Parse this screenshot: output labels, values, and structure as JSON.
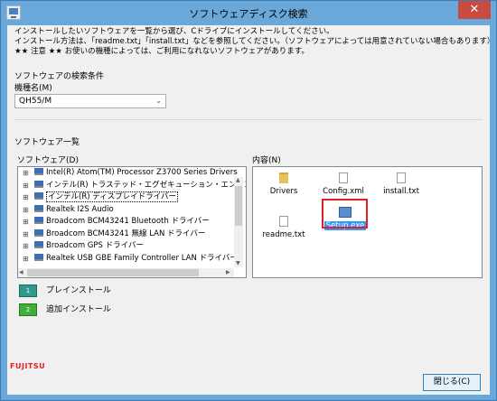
{
  "window": {
    "title": "ソフトウェアディスク検索",
    "close_glyph": "✕"
  },
  "intro": {
    "line1": "インストールしたいソフトウェアを一覧から選び、Cドライブにインストールしてください。",
    "line2": "インストール方法は、「readme.txt」「install.txt」などを参照してください。（ソフトウェアによっては用意されていない場合もあります）",
    "line3": "★★ 注意 ★★ お使いの機種によっては、ご利用になれないソフトウェアがあります。"
  },
  "search": {
    "section_label": "ソフトウェアの検索条件",
    "model_label": "機種名(M)",
    "model_value": "QH55/M"
  },
  "list": {
    "section_label": "ソフトウェア一覧",
    "software_label": "ソフトウェア(D)",
    "items": [
      "Intel(R) Atom(TM) Processor Z3700 Series Drivers",
      "インテル(R) トラステッド・エグゼキューション・エンジン",
      "インテル(R) ディスプレイドライバー",
      "Realtek I2S Audio",
      "Broadcom BCM43241 Bluetooth ドライバー",
      "Broadcom BCM43241 無線 LAN ドライバー",
      "Broadcom GPS ドライバー",
      "Realtek USB GBE Family Controller LAN ドライバー"
    ],
    "expander": "⊞"
  },
  "contents": {
    "label": "内容(N)",
    "files": [
      {
        "name": "Drivers",
        "icon": "folder-icon"
      },
      {
        "name": "Config.xml",
        "icon": "document-icon"
      },
      {
        "name": "install.txt",
        "icon": "document-icon"
      },
      {
        "name": "readme.txt",
        "icon": "document-icon"
      },
      {
        "name": "Setup.exe",
        "icon": "executable-icon"
      }
    ]
  },
  "actions": {
    "preinstall": "プレインストール",
    "preinstall_num": "1",
    "additional": "追加インストール",
    "additional_num": "2"
  },
  "footer": {
    "brand": "FUJITSU",
    "close_button": "閉じる(C)"
  },
  "colors": {
    "title_bar": "#6aa8d9",
    "highlight": "#e41e26",
    "selection": "#3399ff"
  }
}
